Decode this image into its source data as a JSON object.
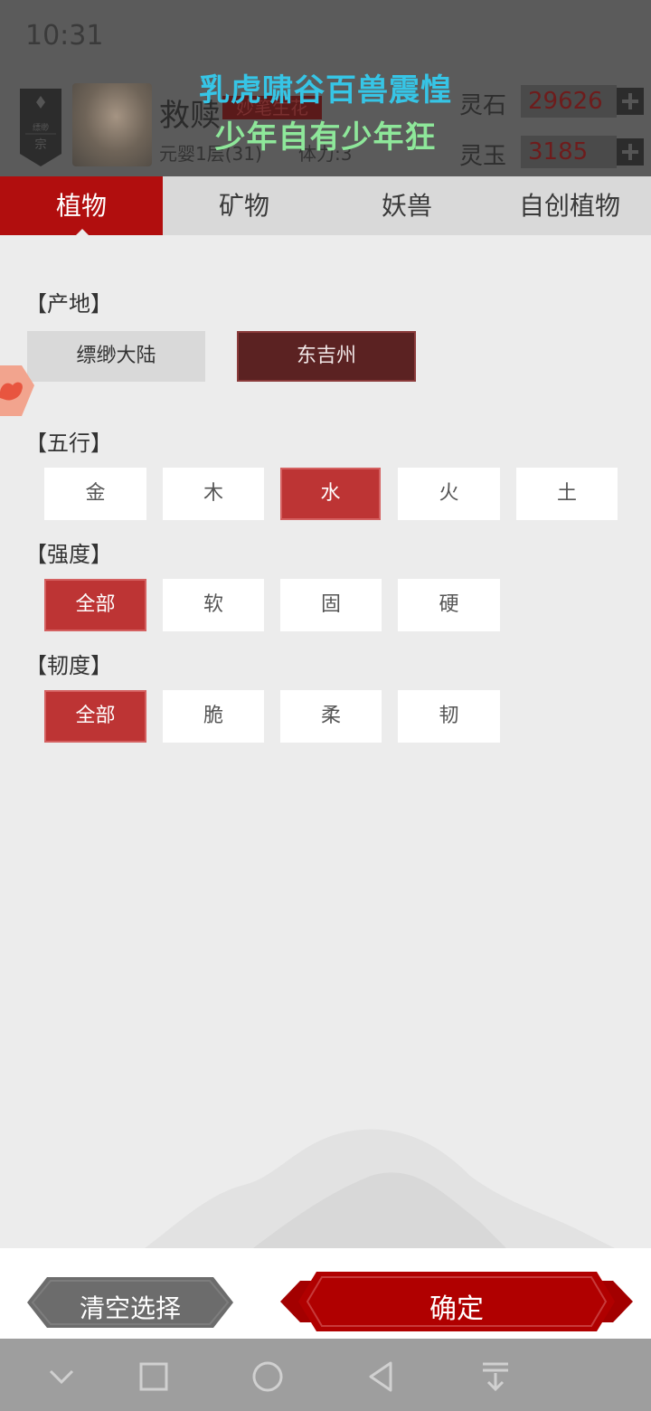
{
  "status_bar": {
    "time": "10:31"
  },
  "header": {
    "sect_name": "缥缈",
    "sect_char": "宗",
    "player_name": "救赎",
    "title_badge": "妙笔生花",
    "realm": "元婴1层(31)",
    "stamina": "体力:3",
    "currencies": [
      {
        "label": "灵石",
        "value": "29626"
      },
      {
        "label": "灵玉",
        "value": "3185"
      }
    ]
  },
  "overlay": {
    "line1": "乳虎啸谷百兽震惶",
    "line2": "少年自有少年狂"
  },
  "tabs": [
    {
      "label": "植物",
      "active": true
    },
    {
      "label": "矿物",
      "active": false
    },
    {
      "label": "妖兽",
      "active": false
    },
    {
      "label": "自创植物",
      "active": false
    }
  ],
  "filters": {
    "origin": {
      "label": "【产地】",
      "options": [
        "缥缈大陆",
        "东吉州"
      ],
      "selected": "东吉州"
    },
    "element": {
      "label": "【五行】",
      "options": [
        "金",
        "木",
        "水",
        "火",
        "土"
      ],
      "selected": "水"
    },
    "strength": {
      "label": "【强度】",
      "options": [
        "全部",
        "软",
        "固",
        "硬"
      ],
      "selected": "全部"
    },
    "toughness": {
      "label": "【韧度】",
      "options": [
        "全部",
        "脆",
        "柔",
        "韧"
      ],
      "selected": "全部"
    }
  },
  "actions": {
    "clear_label": "清空选择",
    "confirm_label": "确定"
  },
  "colors": {
    "accent_red": "#b10e0e",
    "selected_red": "#bd3434",
    "origin_selected": "#5b2222"
  }
}
